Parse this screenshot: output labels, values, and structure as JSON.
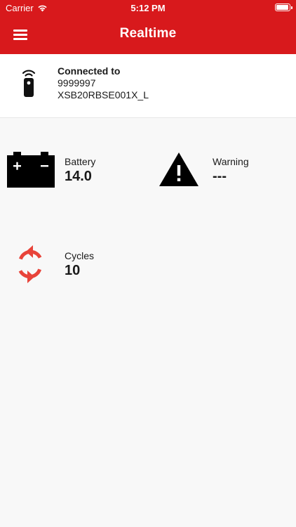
{
  "status_bar": {
    "carrier": "Carrier",
    "time": "5:12 PM"
  },
  "header": {
    "title": "Realtime",
    "background_color": "#d8191c"
  },
  "connection": {
    "title": "Connected to",
    "device_id": "9999997",
    "device_name": "XSB20RBSE001X_L"
  },
  "metrics": {
    "battery": {
      "label": "Battery",
      "value": "14.0",
      "icon": "car-battery-icon"
    },
    "warning": {
      "label": "Warning",
      "value": "---",
      "icon": "warning-triangle-icon"
    },
    "cycles": {
      "label": "Cycles",
      "value": "10",
      "icon": "sync-cycle-icon",
      "icon_color": "#e8443a"
    }
  }
}
